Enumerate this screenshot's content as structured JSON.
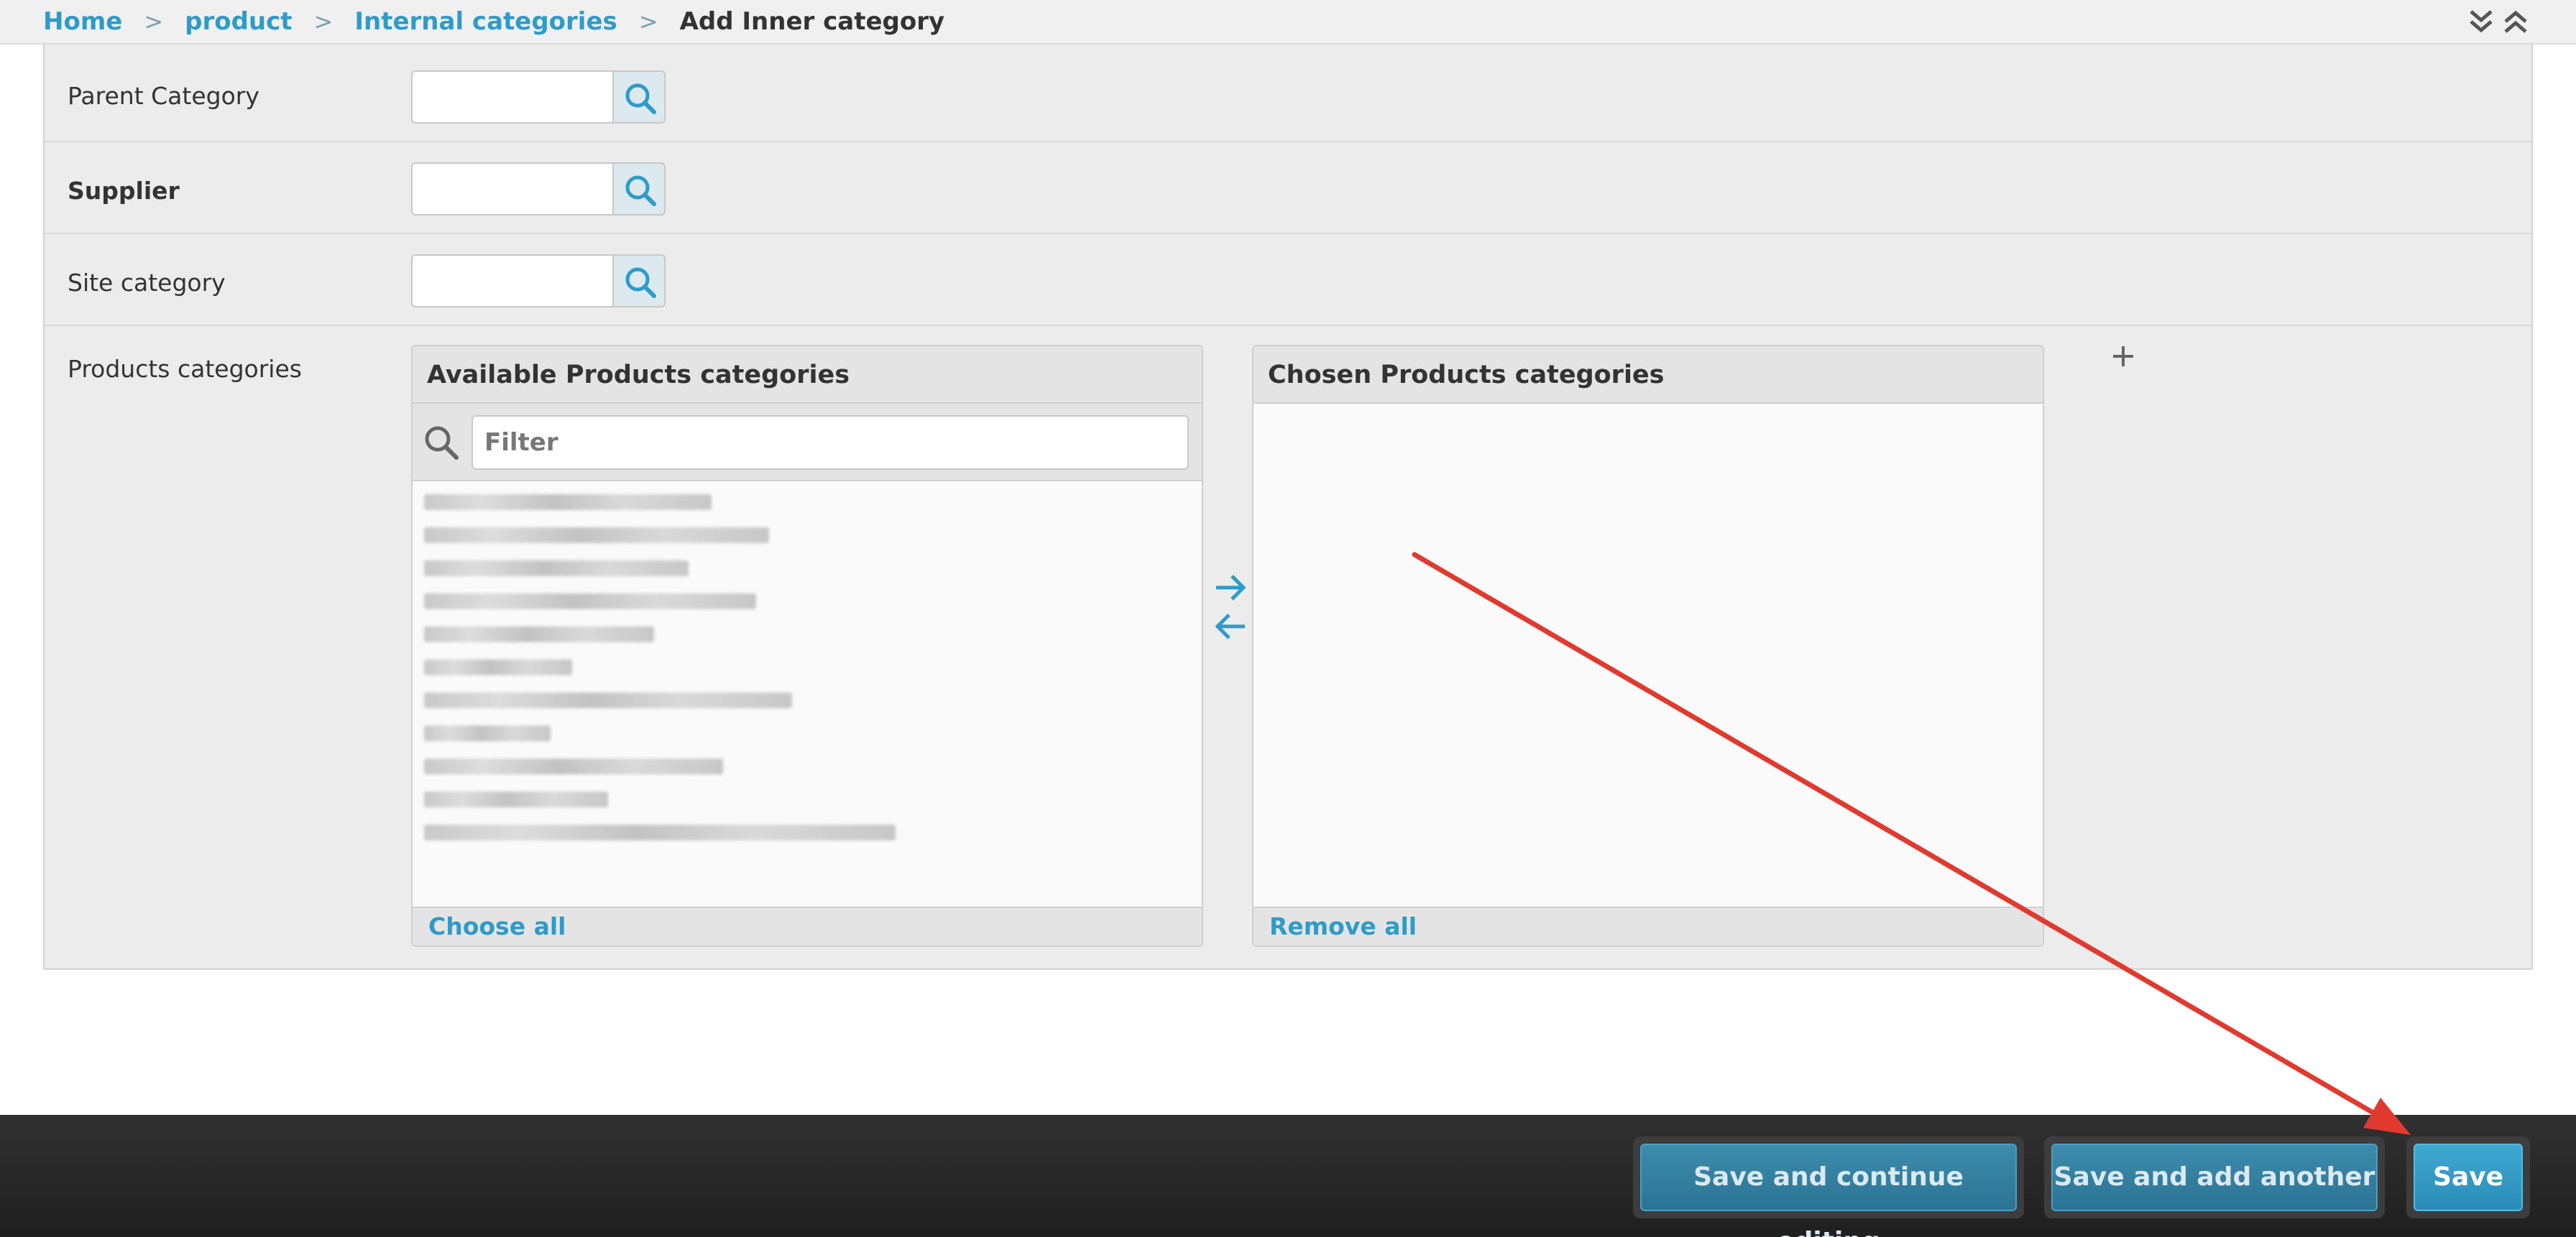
{
  "breadcrumb": {
    "home": "Home",
    "app": "product",
    "model": "Internal categories",
    "current": "Add Inner category",
    "separator": ">"
  },
  "form": {
    "parent_category_label": "Parent Category",
    "supplier_label": "Supplier",
    "site_category_label": "Site category",
    "products_categories_label": "Products categories"
  },
  "selector": {
    "available_title": "Available Products categories",
    "filter_placeholder": "Filter",
    "choose_all": "Choose all",
    "chosen_title": "Chosen Products categories",
    "remove_all": "Remove all"
  },
  "submit": {
    "save_continue": "Save and continue editing",
    "save_add_another": "Save and add another",
    "save": "Save"
  },
  "colors": {
    "link": "#2e9bc9",
    "button": "#3fa9d2",
    "annotation_arrow": "#e03a2f"
  }
}
